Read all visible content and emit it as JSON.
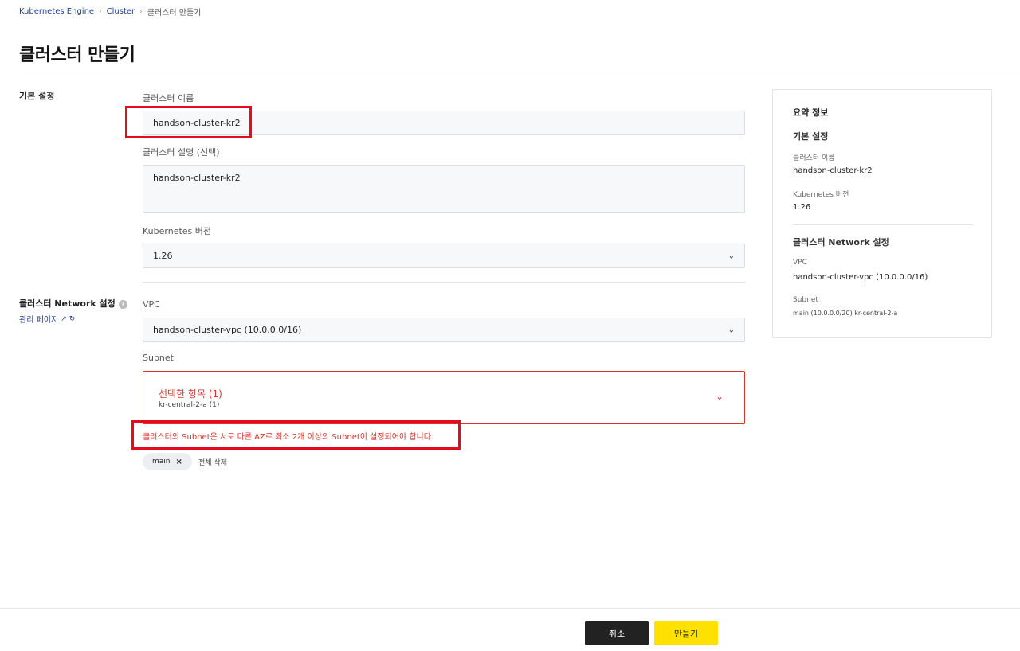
{
  "breadcrumb": [
    "Kubernetes Engine",
    "Cluster",
    "클러스터 만들기"
  ],
  "title": "클러스터 만들기",
  "sections": {
    "basic": "기본 설정",
    "network": "클러스터 Network 설정",
    "manage_link": "관리 페이지"
  },
  "form": {
    "cluster_name_label": "클러스터 이름",
    "cluster_name": "handson-cluster-kr2",
    "description_label": "클러스터 설명 (선택)",
    "description": "handson-cluster-kr2",
    "version_label": "Kubernetes 버전",
    "version": "1.26",
    "vpc_label": "VPC",
    "vpc": "handson-cluster-vpc (10.0.0.0/16)",
    "subnet_label": "Subnet",
    "subnet_selected_title": "선택한 항목 (1)",
    "subnet_selected_sub": "kr-central-2-a (1)",
    "subnet_error": "클러스터의 Subnet은 서로 다른 AZ로 최소 2개 이상의 Subnet이 설정되어야 합니다.",
    "chip": "main",
    "clear_all": "전체 삭제"
  },
  "summary": {
    "title": "요약 정보",
    "basic_title": "기본 설정",
    "name_label": "클러스터 이름",
    "name": "handson-cluster-kr2",
    "version_label": "Kubernetes 버전",
    "version": "1.26",
    "network_title": "클러스터 Network 설정",
    "vpc_label": "VPC",
    "vpc": "handson-cluster-vpc (10.0.0.0/16)",
    "subnet_label": "Subnet",
    "subnet": "main (10.0.0.0/20) kr-central-2-a"
  },
  "buttons": {
    "cancel": "취소",
    "create": "만들기"
  },
  "icons": {
    "chevron": "chevron-down-icon",
    "help": "help-icon",
    "external": "external-link-icon",
    "refresh": "refresh-icon",
    "close": "close-icon"
  },
  "colors": {
    "error": "#d9342b",
    "highlight": "#e8091e",
    "primary": "#ffe100",
    "dark": "#222222"
  }
}
